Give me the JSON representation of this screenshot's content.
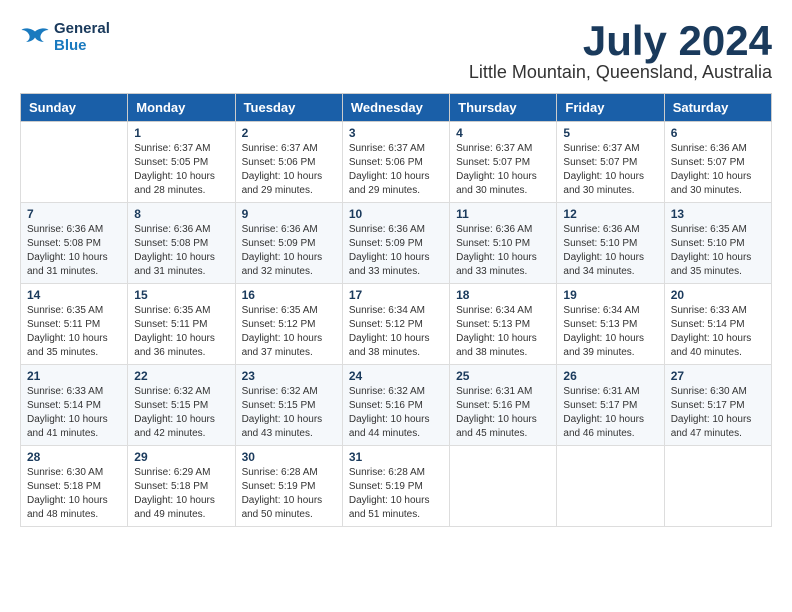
{
  "header": {
    "logo_line1": "General",
    "logo_line2": "Blue",
    "month": "July 2024",
    "location": "Little Mountain, Queensland, Australia"
  },
  "weekdays": [
    "Sunday",
    "Monday",
    "Tuesday",
    "Wednesday",
    "Thursday",
    "Friday",
    "Saturday"
  ],
  "weeks": [
    [
      {
        "day": "",
        "info": ""
      },
      {
        "day": "1",
        "info": "Sunrise: 6:37 AM\nSunset: 5:05 PM\nDaylight: 10 hours\nand 28 minutes."
      },
      {
        "day": "2",
        "info": "Sunrise: 6:37 AM\nSunset: 5:06 PM\nDaylight: 10 hours\nand 29 minutes."
      },
      {
        "day": "3",
        "info": "Sunrise: 6:37 AM\nSunset: 5:06 PM\nDaylight: 10 hours\nand 29 minutes."
      },
      {
        "day": "4",
        "info": "Sunrise: 6:37 AM\nSunset: 5:07 PM\nDaylight: 10 hours\nand 30 minutes."
      },
      {
        "day": "5",
        "info": "Sunrise: 6:37 AM\nSunset: 5:07 PM\nDaylight: 10 hours\nand 30 minutes."
      },
      {
        "day": "6",
        "info": "Sunrise: 6:36 AM\nSunset: 5:07 PM\nDaylight: 10 hours\nand 30 minutes."
      }
    ],
    [
      {
        "day": "7",
        "info": "Sunrise: 6:36 AM\nSunset: 5:08 PM\nDaylight: 10 hours\nand 31 minutes."
      },
      {
        "day": "8",
        "info": "Sunrise: 6:36 AM\nSunset: 5:08 PM\nDaylight: 10 hours\nand 31 minutes."
      },
      {
        "day": "9",
        "info": "Sunrise: 6:36 AM\nSunset: 5:09 PM\nDaylight: 10 hours\nand 32 minutes."
      },
      {
        "day": "10",
        "info": "Sunrise: 6:36 AM\nSunset: 5:09 PM\nDaylight: 10 hours\nand 33 minutes."
      },
      {
        "day": "11",
        "info": "Sunrise: 6:36 AM\nSunset: 5:10 PM\nDaylight: 10 hours\nand 33 minutes."
      },
      {
        "day": "12",
        "info": "Sunrise: 6:36 AM\nSunset: 5:10 PM\nDaylight: 10 hours\nand 34 minutes."
      },
      {
        "day": "13",
        "info": "Sunrise: 6:35 AM\nSunset: 5:10 PM\nDaylight: 10 hours\nand 35 minutes."
      }
    ],
    [
      {
        "day": "14",
        "info": "Sunrise: 6:35 AM\nSunset: 5:11 PM\nDaylight: 10 hours\nand 35 minutes."
      },
      {
        "day": "15",
        "info": "Sunrise: 6:35 AM\nSunset: 5:11 PM\nDaylight: 10 hours\nand 36 minutes."
      },
      {
        "day": "16",
        "info": "Sunrise: 6:35 AM\nSunset: 5:12 PM\nDaylight: 10 hours\nand 37 minutes."
      },
      {
        "day": "17",
        "info": "Sunrise: 6:34 AM\nSunset: 5:12 PM\nDaylight: 10 hours\nand 38 minutes."
      },
      {
        "day": "18",
        "info": "Sunrise: 6:34 AM\nSunset: 5:13 PM\nDaylight: 10 hours\nand 38 minutes."
      },
      {
        "day": "19",
        "info": "Sunrise: 6:34 AM\nSunset: 5:13 PM\nDaylight: 10 hours\nand 39 minutes."
      },
      {
        "day": "20",
        "info": "Sunrise: 6:33 AM\nSunset: 5:14 PM\nDaylight: 10 hours\nand 40 minutes."
      }
    ],
    [
      {
        "day": "21",
        "info": "Sunrise: 6:33 AM\nSunset: 5:14 PM\nDaylight: 10 hours\nand 41 minutes."
      },
      {
        "day": "22",
        "info": "Sunrise: 6:32 AM\nSunset: 5:15 PM\nDaylight: 10 hours\nand 42 minutes."
      },
      {
        "day": "23",
        "info": "Sunrise: 6:32 AM\nSunset: 5:15 PM\nDaylight: 10 hours\nand 43 minutes."
      },
      {
        "day": "24",
        "info": "Sunrise: 6:32 AM\nSunset: 5:16 PM\nDaylight: 10 hours\nand 44 minutes."
      },
      {
        "day": "25",
        "info": "Sunrise: 6:31 AM\nSunset: 5:16 PM\nDaylight: 10 hours\nand 45 minutes."
      },
      {
        "day": "26",
        "info": "Sunrise: 6:31 AM\nSunset: 5:17 PM\nDaylight: 10 hours\nand 46 minutes."
      },
      {
        "day": "27",
        "info": "Sunrise: 6:30 AM\nSunset: 5:17 PM\nDaylight: 10 hours\nand 47 minutes."
      }
    ],
    [
      {
        "day": "28",
        "info": "Sunrise: 6:30 AM\nSunset: 5:18 PM\nDaylight: 10 hours\nand 48 minutes."
      },
      {
        "day": "29",
        "info": "Sunrise: 6:29 AM\nSunset: 5:18 PM\nDaylight: 10 hours\nand 49 minutes."
      },
      {
        "day": "30",
        "info": "Sunrise: 6:28 AM\nSunset: 5:19 PM\nDaylight: 10 hours\nand 50 minutes."
      },
      {
        "day": "31",
        "info": "Sunrise: 6:28 AM\nSunset: 5:19 PM\nDaylight: 10 hours\nand 51 minutes."
      },
      {
        "day": "",
        "info": ""
      },
      {
        "day": "",
        "info": ""
      },
      {
        "day": "",
        "info": ""
      }
    ]
  ]
}
